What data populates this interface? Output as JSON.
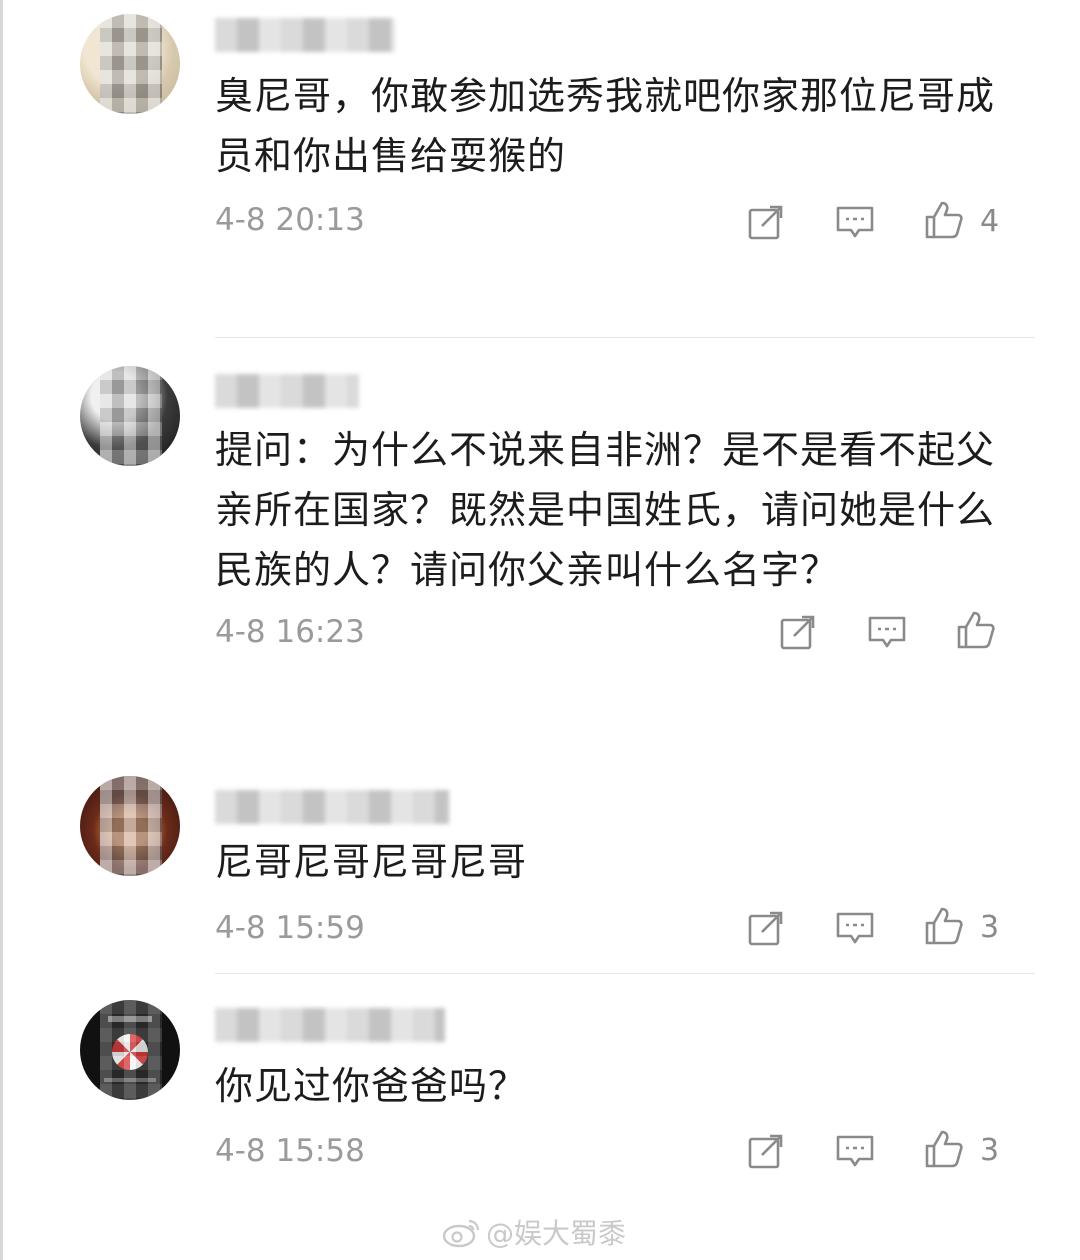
{
  "comments": [
    {
      "text": "臭尼哥，你敢参加选秀我就吧你家那位尼哥成员和你出售给耍猴的",
      "time": "4-8 20:13",
      "likes": "4"
    },
    {
      "text": "提问：为什么不说来自非洲？是不是看不起父亲所在国家？既然是中国姓氏，请问她是什么民族的人？请问你父亲叫什么名字？",
      "time": "4-8 16:23",
      "likes": ""
    },
    {
      "text": "尼哥尼哥尼哥尼哥",
      "time": "4-8 15:59",
      "likes": "3"
    },
    {
      "text": "你见过你爸爸吗？",
      "time": "4-8 15:58",
      "likes": "3"
    }
  ],
  "icons": {
    "share": "share-icon",
    "reply": "comment-icon",
    "like": "thumbs-up-icon"
  },
  "watermark": "@娱大蜀黍",
  "colors": {
    "text": "#1c1c1c",
    "meta": "#9a9a9a",
    "icon": "#8a8a8a",
    "divider": "#e6e6e6"
  }
}
